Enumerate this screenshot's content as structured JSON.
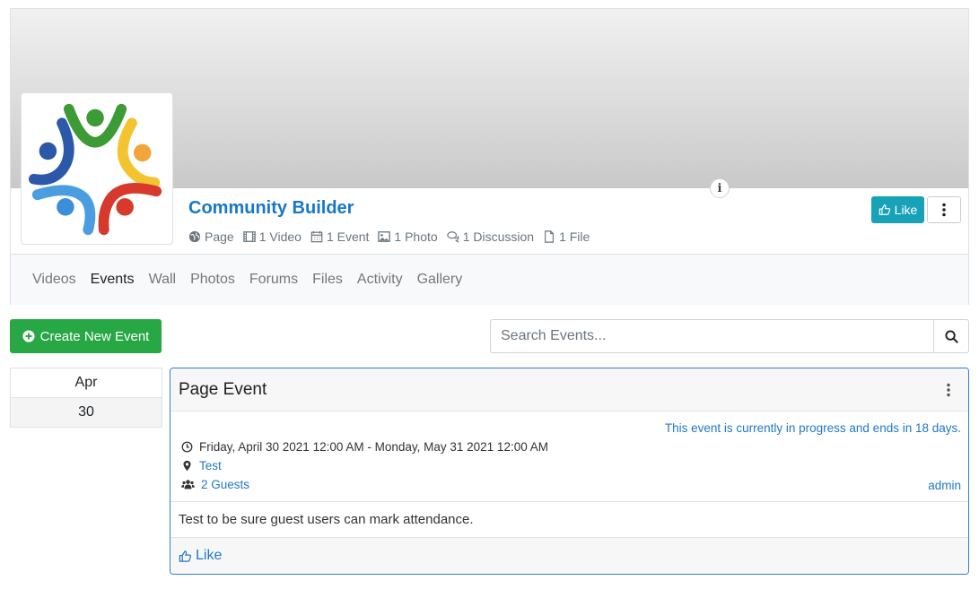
{
  "page": {
    "title": "Community Builder",
    "counters": [
      {
        "icon": "globe-icon",
        "text": "Page"
      },
      {
        "icon": "film-icon",
        "text": "1 Video"
      },
      {
        "icon": "calendar-icon",
        "text": "1 Event"
      },
      {
        "icon": "image-icon",
        "text": "1 Photo"
      },
      {
        "icon": "comments-icon",
        "text": "1 Discussion"
      },
      {
        "icon": "file-icon",
        "text": "1 File"
      }
    ],
    "like_label": "Like"
  },
  "tabs": [
    {
      "label": "Videos",
      "active": false
    },
    {
      "label": "Events",
      "active": true
    },
    {
      "label": "Wall",
      "active": false
    },
    {
      "label": "Photos",
      "active": false
    },
    {
      "label": "Forums",
      "active": false
    },
    {
      "label": "Files",
      "active": false
    },
    {
      "label": "Activity",
      "active": false
    },
    {
      "label": "Gallery",
      "active": false
    }
  ],
  "toolbar": {
    "create_label": "Create New Event",
    "search_placeholder": "Search Events..."
  },
  "event": {
    "month": "Apr",
    "day": "30",
    "title": "Page Event",
    "status": "This event is currently in progress and ends in 18 days.",
    "datetime": "Friday, April 30 2021 12:00 AM - Monday, May 31 2021 12:00 AM",
    "location": "Test",
    "guests": "2 Guests",
    "owner": "admin",
    "description": "Test to be sure guest users can mark attendance.",
    "like_label": "Like"
  },
  "colors": {
    "brand_blue": "#1877c9",
    "like_teal": "#17a2b8",
    "create_green": "#28a745"
  }
}
